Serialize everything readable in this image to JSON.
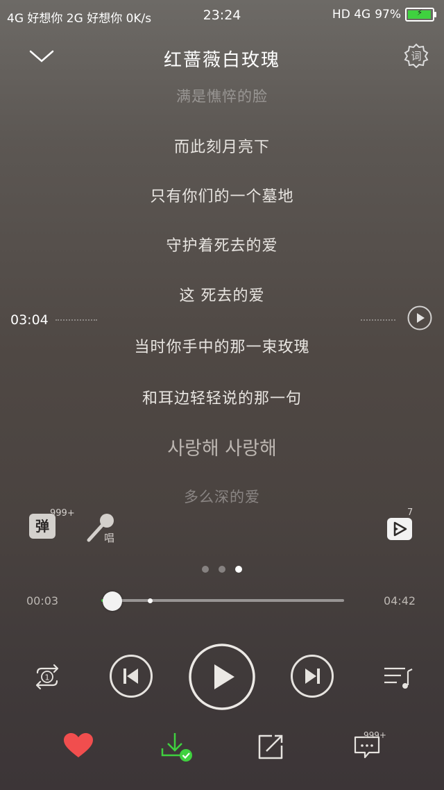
{
  "status_bar": {
    "left": "4G 好想你 2G 好想你  0K/s",
    "time": "23:24",
    "network": "HD 4G",
    "battery": "97%",
    "battery_level": 0.97
  },
  "header": {
    "title": "红蔷薇白玫瑰",
    "lyrics_button": "词"
  },
  "lyrics": [
    "满是憔悴的脸",
    "而此刻月亮下",
    "只有你们的一个墓地",
    "守护着死去的爱",
    "这 死去的爱",
    "当时你手中的那一束玫瑰",
    "和耳边轻轻说的那一句",
    "사랑해 사랑해",
    "多么深的爱"
  ],
  "seek_marker": {
    "time": "03:04"
  },
  "actions": {
    "danmaku_label": "弹",
    "danmaku_count": "999+",
    "sing_label": "唱",
    "video_count": "7"
  },
  "pager": {
    "count": 3,
    "active": 2
  },
  "progress": {
    "current": "00:03",
    "duration": "04:42",
    "played_fraction": 0.011,
    "buffered_fraction": 0.2
  },
  "bottom_bar": {
    "comment_count": "999+"
  },
  "colors": {
    "accent": "#3fd13f",
    "heart": "#f14e4e"
  }
}
